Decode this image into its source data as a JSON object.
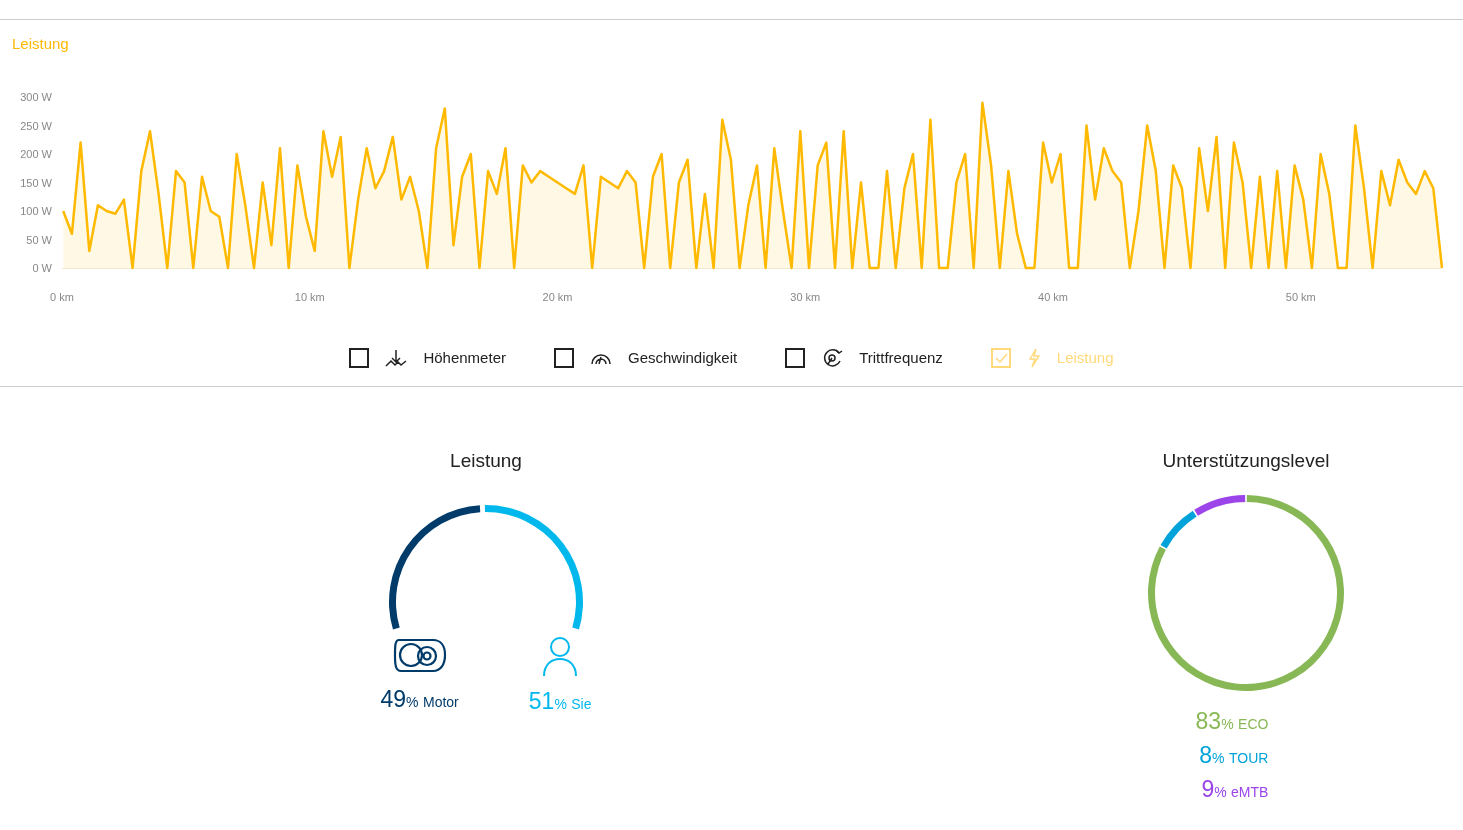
{
  "power_chart": {
    "chart_data": {
      "type": "area",
      "xlim": [
        0,
        55.7
      ],
      "ylim": [
        0,
        300
      ],
      "xticks": [
        {
          "value": 0,
          "label": "0 km"
        },
        {
          "value": 10,
          "label": "10 km"
        },
        {
          "value": 20,
          "label": "20 km"
        },
        {
          "value": 30,
          "label": "30 km"
        },
        {
          "value": 40,
          "label": "40 km"
        },
        {
          "value": 50,
          "label": "50 km"
        }
      ],
      "yticks": [
        {
          "value": 300,
          "label": "300 W"
        },
        {
          "value": 250,
          "label": "250 W"
        },
        {
          "value": 200,
          "label": "200 W"
        },
        {
          "value": 150,
          "label": "150 W"
        },
        {
          "value": 100,
          "label": "100 W"
        },
        {
          "value": 50,
          "label": "50 W"
        },
        {
          "value": 0,
          "label": "0 W"
        }
      ],
      "x": [
        0.05,
        0.4,
        0.75,
        1.1,
        1.45,
        1.8,
        2.15,
        2.5,
        2.85,
        3.2,
        3.55,
        3.9,
        4.25,
        4.6,
        4.95,
        5.3,
        5.65,
        6,
        6.35,
        6.7,
        7.05,
        7.4,
        7.75,
        8.1,
        8.45,
        8.8,
        9.15,
        9.5,
        9.85,
        10.2,
        10.55,
        10.9,
        11.25,
        11.6,
        11.95,
        12.3,
        12.65,
        13,
        13.35,
        13.7,
        14.05,
        14.4,
        14.75,
        15.1,
        15.45,
        15.8,
        16.15,
        16.5,
        16.85,
        17.2,
        17.55,
        17.9,
        18.25,
        18.6,
        18.95,
        19.3,
        19.65,
        20,
        20.35,
        20.7,
        21.05,
        21.4,
        21.75,
        22.1,
        22.45,
        22.8,
        23.15,
        23.5,
        23.85,
        24.2,
        24.55,
        24.9,
        25.25,
        25.6,
        25.95,
        26.3,
        26.65,
        27,
        27.35,
        27.7,
        28.05,
        28.4,
        28.75,
        29.1,
        29.45,
        29.8,
        30.15,
        30.5,
        30.85,
        31.2,
        31.55,
        31.9,
        32.25,
        32.6,
        32.95,
        33.3,
        33.65,
        34,
        34.35,
        34.7,
        35.05,
        35.4,
        35.75,
        36.1,
        36.45,
        36.8,
        37.15,
        37.5,
        37.85,
        38.2,
        38.55,
        38.9,
        39.25,
        39.6,
        39.95,
        40.3,
        40.65,
        41,
        41.35,
        41.7,
        42.05,
        42.4,
        42.75,
        43.1,
        43.45,
        43.8,
        44.15,
        44.5,
        44.85,
        45.2,
        45.55,
        45.9,
        46.25,
        46.6,
        46.95,
        47.3,
        47.65,
        48,
        48.35,
        48.7,
        49.05,
        49.4,
        49.75,
        50.1,
        50.45,
        50.8,
        51.15,
        51.5,
        51.85,
        52.2,
        52.55,
        52.9,
        53.25,
        53.6,
        53.95,
        54.3,
        54.65,
        55,
        55.35,
        55.7
      ],
      "series": [
        {
          "name": "Leistung",
          "color": "#ffb900",
          "values": [
            100,
            60,
            220,
            30,
            110,
            100,
            95,
            120,
            0,
            170,
            240,
            130,
            0,
            170,
            150,
            0,
            160,
            100,
            90,
            0,
            200,
            110,
            0,
            150,
            40,
            210,
            0,
            180,
            90,
            30,
            240,
            160,
            230,
            0,
            120,
            210,
            140,
            170,
            230,
            120,
            160,
            100,
            0,
            210,
            280,
            40,
            160,
            200,
            0,
            170,
            130,
            210,
            0,
            180,
            150,
            170,
            160,
            150,
            140,
            130,
            180,
            0,
            160,
            150,
            140,
            170,
            150,
            0,
            160,
            200,
            0,
            150,
            190,
            0,
            130,
            0,
            260,
            190,
            0,
            110,
            180,
            0,
            210,
            100,
            0,
            240,
            0,
            180,
            220,
            0,
            240,
            0,
            150,
            0,
            0,
            170,
            0,
            140,
            200,
            0,
            260,
            0,
            0,
            150,
            200,
            0,
            290,
            180,
            0,
            170,
            60,
            0,
            0,
            220,
            150,
            200,
            0,
            0,
            250,
            120,
            210,
            170,
            150,
            0,
            100,
            250,
            170,
            0,
            180,
            140,
            0,
            210,
            100,
            230,
            0,
            220,
            150,
            0,
            160,
            0,
            170,
            0,
            180,
            120,
            0,
            200,
            130,
            0,
            0,
            250,
            140,
            0,
            170,
            110,
            190,
            150,
            130,
            170,
            140,
            0
          ]
        }
      ]
    }
  },
  "legend": [
    {
      "kind": "elevation",
      "label": "Höhenmeter",
      "checked": false
    },
    {
      "kind": "speed",
      "label": "Geschwindigkeit",
      "checked": false
    },
    {
      "kind": "cadence",
      "label": "Trittfrequenz",
      "checked": false
    },
    {
      "kind": "power",
      "label": "Leistung",
      "checked": true
    }
  ],
  "power_split": {
    "title": "Leistung",
    "parts": [
      {
        "kind": "motor",
        "value": "49",
        "unit": "%",
        "label": "Motor",
        "color": "#003b6a"
      },
      {
        "kind": "rider",
        "value": "51",
        "unit": "%",
        "label": "Sie",
        "color": "#00b8ec"
      }
    ]
  },
  "support_levels": {
    "chart_data": {
      "type": "donut",
      "categories": [
        "ECO",
        "TOUR",
        "eMTB"
      ],
      "series": [
        {
          "name": "Unterstützungslevel",
          "values": [
            83,
            8,
            9
          ]
        }
      ]
    },
    "parts": [
      {
        "value": "83",
        "unit": "%",
        "color": "#88b856"
      },
      {
        "value": "8",
        "unit": "%",
        "color": "#00a3d9"
      },
      {
        "value": "9",
        "unit": "%",
        "color": "#9b44ea"
      }
    ]
  }
}
